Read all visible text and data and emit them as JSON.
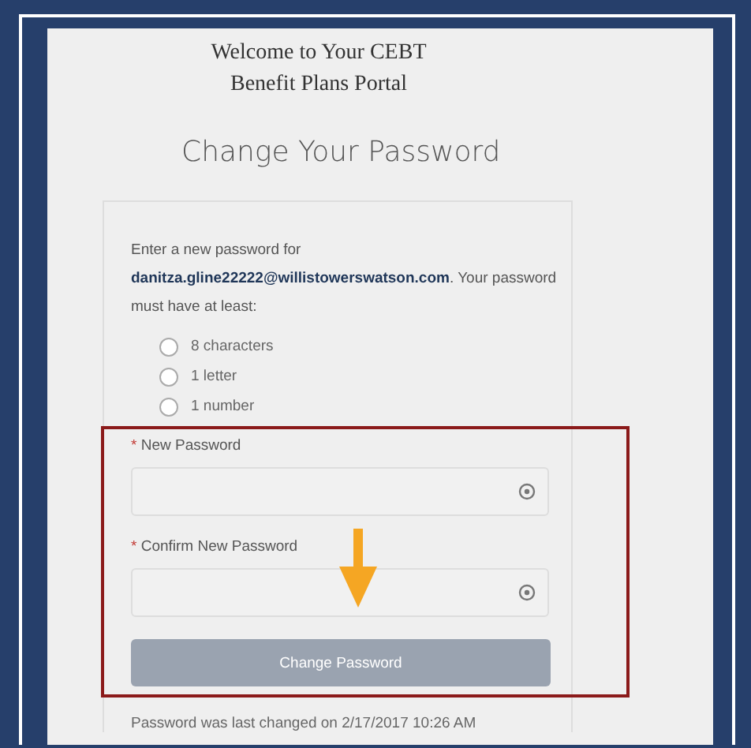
{
  "header": {
    "title_lines": [
      "Welcome to Your CEBT",
      "Benefit Plans Portal"
    ]
  },
  "heading": "Change Your Password",
  "intro": "Enter a new password for **danitza.gline22222@willistowerswatson.com**. Your password must have at least:",
  "requirements": [
    {
      "label": "8 characters",
      "checked": false
    },
    {
      "label": "1 letter",
      "checked": false
    },
    {
      "label": "1 number",
      "checked": false
    }
  ],
  "fields": [
    {
      "marker": "*",
      "label": "New Password"
    },
    {
      "marker": "*",
      "label": "Confirm New Password"
    }
  ],
  "submit": {
    "label": "Change Password",
    "disabled": true
  },
  "footer_note": "Password was last changed on 2/17/2017 10:26 AM"
}
